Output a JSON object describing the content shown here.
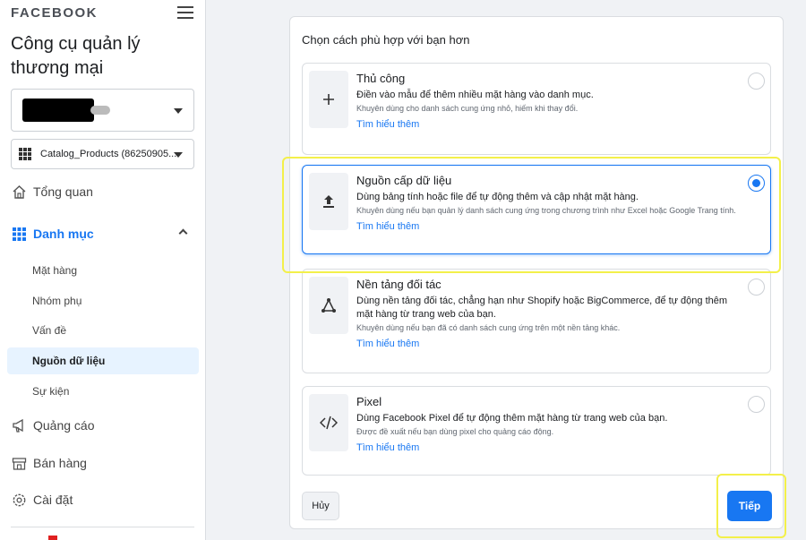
{
  "sidebar": {
    "brand": "FACEBOOK",
    "title": "Công cụ quản lý thương mại",
    "catalog_select": "Catalog_Products (86250905...",
    "nav": {
      "overview": "Tổng quan",
      "catalog": "Danh mục",
      "ads": "Quảng cáo",
      "sales": "Bán hàng",
      "settings": "Cài đặt"
    },
    "sub_items": {
      "items": "Mặt hàng",
      "sets": "Nhóm phụ",
      "issues": "Vấn đề",
      "data_sources": "Nguồn dữ liệu",
      "events": "Sự kiện"
    }
  },
  "main": {
    "heading": "Chọn cách phù hợp với bạn hơn",
    "options": [
      {
        "title": "Thủ công",
        "desc": "Điền vào mẫu để thêm nhiều mặt hàng vào danh mục.",
        "note": "Khuyên dùng cho danh sách cung ứng nhỏ, hiếm khi thay đổi.",
        "link": "Tìm hiểu thêm",
        "icon": "plus-icon",
        "selected": false
      },
      {
        "title": "Nguồn cấp dữ liệu",
        "desc": "Dùng bảng tính hoặc file để tự động thêm và cập nhật mặt hàng.",
        "note": "Khuyên dùng nếu bạn quản lý danh sách cung ứng trong chương trình như Excel hoặc Google Trang tính.",
        "link": "Tìm hiểu thêm",
        "icon": "upload-icon",
        "selected": true
      },
      {
        "title": "Nền tảng đối tác",
        "desc": "Dùng nền tảng đối tác, chẳng hạn như Shopify hoặc BigCommerce, để tự động thêm mặt hàng từ trang web của bạn.",
        "note": "Khuyên dùng nếu bạn đã có danh sách cung ứng trên một nền tảng khác.",
        "link": "Tìm hiểu thêm",
        "icon": "partner-nodes-icon",
        "selected": false
      },
      {
        "title": "Pixel",
        "desc": "Dùng Facebook Pixel để tự động thêm mặt hàng từ trang web của bạn.",
        "note": "Được đề xuất nếu bạn dùng pixel cho quảng cáo động.",
        "link": "Tìm hiểu thêm",
        "icon": "code-icon",
        "selected": false
      }
    ],
    "cancel_label": "Hủy",
    "next_label": "Tiếp"
  },
  "colors": {
    "accent": "#1877f2",
    "highlight": "#f3f04a",
    "selected_nav_bg": "#e7f3ff"
  }
}
